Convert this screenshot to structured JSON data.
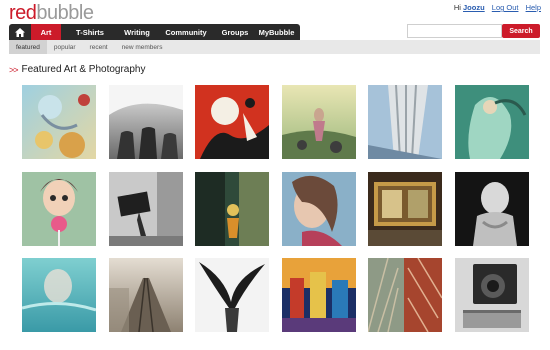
{
  "logo": {
    "part1": "red",
    "part2": "bubble"
  },
  "userbar": {
    "greeting": "Hi",
    "username": "Joozu",
    "logout": "Log Out",
    "help": "Help"
  },
  "nav": {
    "home_icon": "home-icon",
    "items": [
      "Art",
      "T-Shirts",
      "Writing",
      "Community",
      "Groups",
      "MyBubble"
    ],
    "active": "Art"
  },
  "search": {
    "placeholder": "",
    "button": "Search"
  },
  "subnav": {
    "items": [
      "featured",
      "popular",
      "recent",
      "new members"
    ],
    "active": "featured"
  },
  "heading": {
    "arrows": ">>",
    "title": "Featured Art & Photography"
  },
  "colors": {
    "accent": "#cc1b2a",
    "nav_bg": "#2a2a2a",
    "subnav_bg": "#e8e8e8"
  },
  "gallery": {
    "rows": 3,
    "columns": 6,
    "count": 18
  }
}
